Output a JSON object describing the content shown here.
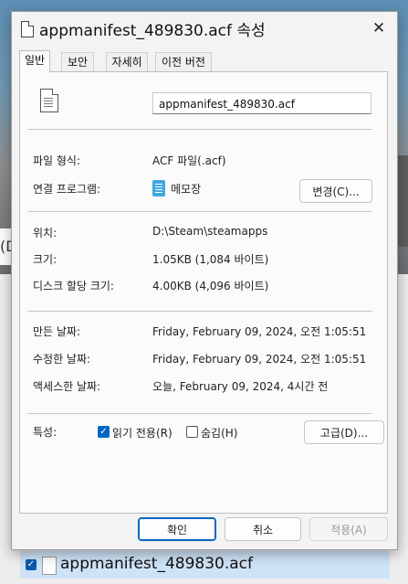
{
  "background": {
    "sliver_text": "(D",
    "file_row_name": "appmanifest_489830.acf"
  },
  "dialog": {
    "title": "appmanifest_489830.acf 속성",
    "close_glyph": "✕"
  },
  "tabs": [
    {
      "label": "일반",
      "active": true
    },
    {
      "label": "보안",
      "active": false
    },
    {
      "label": "자세히",
      "active": false
    },
    {
      "label": "이전 버전",
      "active": false
    }
  ],
  "general": {
    "file_name": "appmanifest_489830.acf",
    "file_type_label": "파일 형식:",
    "file_type_value": "ACF 파일(.acf)",
    "opens_with_label": "연결 프로그램:",
    "opens_with_value": "메모장",
    "change_button": "변경(C)...",
    "location_label": "위치:",
    "location_value": "D:\\Steam\\steamapps",
    "size_label": "크기:",
    "size_value": "1.05KB (1,084 바이트)",
    "size_on_disk_label": "디스크 할당 크기:",
    "size_on_disk_value": "4.00KB (4,096 바이트)",
    "created_label": "만든 날짜:",
    "created_value": "Friday, February 09, 2024, 오전 1:05:51",
    "modified_label": "수정한 날짜:",
    "modified_value": "Friday, February 09, 2024, 오전 1:05:51",
    "accessed_label": "액세스한 날짜:",
    "accessed_value": "오늘, February 09, 2024, 4시간 전",
    "attributes_label": "특성:",
    "readonly_label": "읽기 전용(R)",
    "readonly_checked": true,
    "hidden_label": "숨김(H)",
    "hidden_checked": false,
    "advanced_button": "고급(D)..."
  },
  "footer": {
    "ok_button": "확인",
    "cancel_button": "취소",
    "apply_button": "적용(A)"
  },
  "colors": {
    "accent": "#0067c0",
    "notepad_icon": "#3fa7e0"
  }
}
